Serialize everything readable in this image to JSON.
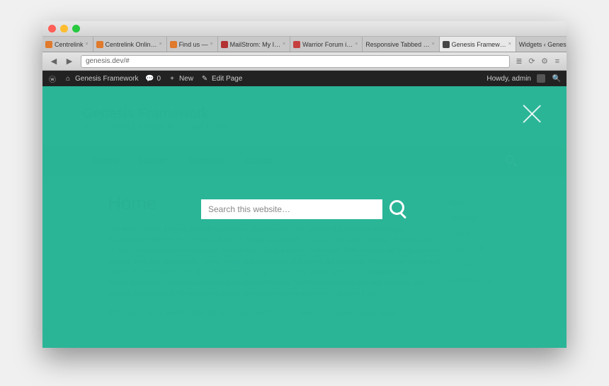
{
  "browser": {
    "url": "genesis.dev/#",
    "tabs": [
      {
        "label": "Centrelink",
        "favClass": "orange"
      },
      {
        "label": "Centrelink Onlin…",
        "favClass": "orange"
      },
      {
        "label": "Find us —",
        "favClass": "orange"
      },
      {
        "label": "MailStrom: My I…",
        "favClass": "red"
      },
      {
        "label": "Warrior Forum i…",
        "favClass": "redw"
      },
      {
        "label": "Responsive Tabbed …",
        "favClass": ""
      },
      {
        "label": "Genesis Framew…",
        "favClass": "w",
        "active": true
      },
      {
        "label": "Widgets ‹ Genesis Fr…",
        "favClass": ""
      }
    ],
    "newtab": "+"
  },
  "wp_admin": {
    "site": "Genesis Framework",
    "comments": "0",
    "new": "New",
    "edit_page": "Edit Page",
    "howdy": "Howdy, admin"
  },
  "site": {
    "title": "Genesis Framework",
    "tagline": "Supports HTML5 & Mobile Responsive Design"
  },
  "nav": {
    "items": [
      "Sample",
      "Layouts",
      "Templates",
      "Contact"
    ]
  },
  "page": {
    "heading": "Home",
    "body": "Sed dictum lorem, tristique porttitor sit interdum ultricies ante. Sed posuere dui sed euismod congue. Pellentesque tellus ligula, commodo id nisi id, feugiat luctus nulla. Nulla id ipsum diam. Aenean sit amet augue mi. Sed vehicula posuere malesuada. Praesent sed congue purus, a mattis mi. Pellentesque nec purus vehicula, volutpat eros non, aliquet justo. Donec mollis gravida massa, id posuere nisi ultrices at. Pellentesque consequat massa at, condimentum orci. Duis bibendum, tellus quis finibus accumsan, ante purus venenatis neque, id tempor leo mi nec. Praesent commodo tellus quis felis feugiat. Sed hendrerit ipsum nec sem molestie, sed dapibus lacus posuere. Praesent ante purus, eleifend in pellentesque eget, vulputate a dui.",
    "body2": "Cras tempor lacus, eleifend vitae est sed suscipit eleifend enim. Vivamus et sapien magna. Nulla"
  },
  "sidebar": {
    "heading": "Meta",
    "items": [
      "Site Admin",
      "Log out",
      "Entries RSS",
      "Comments RSS",
      "WordPress.org"
    ]
  },
  "search": {
    "placeholder": "Search this website…"
  }
}
